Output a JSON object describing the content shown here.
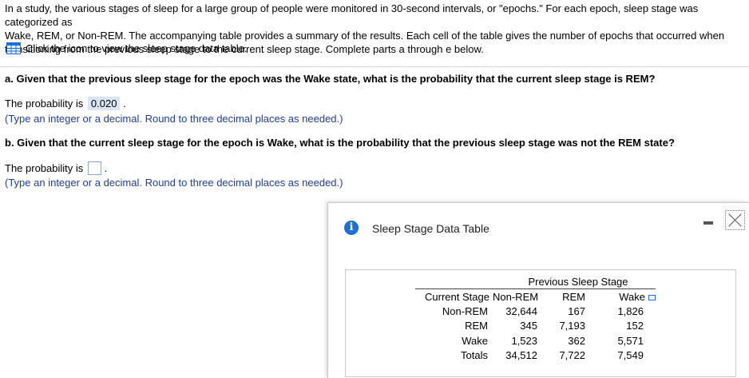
{
  "intro": {
    "line1": "In a study, the various stages of sleep for a large group of people were monitored in 30-second intervals, or \"epochs.\" For each epoch, sleep stage was categorized as",
    "line2": "Wake, REM, or Non-REM. The accompanying table provides a summary of the results. Each cell of the table gives the number of epochs that occurred when",
    "line3": "transitioning from the previous sleep stage to the current sleep stage. Complete parts a through e below.",
    "icon_link_text": "Click the icon to view the sleep stage data table."
  },
  "part_a": {
    "question": "a. Given that the previous sleep stage for the epoch was the Wake state, what is the probability that the current sleep stage is REM?",
    "answer_prefix": "The probability is",
    "answer_value": "0.020",
    "answer_suffix": ".",
    "hint": "(Type an integer or a decimal. Round to three decimal places as needed.)"
  },
  "part_b": {
    "question": "b. Given that the current sleep stage for the epoch is Wake, what is the probability that the previous sleep stage was not the REM state?",
    "answer_prefix": "The probability is",
    "answer_value": "",
    "answer_suffix": ".",
    "hint": "(Type an integer or a decimal. Round to three decimal places as needed.)"
  },
  "popup": {
    "title": "Sleep Stage Data Table",
    "table": {
      "group_header": "Previous Sleep Stage",
      "stub_header": "Current Stage",
      "columns": [
        "Non-REM",
        "REM",
        "Wake"
      ],
      "rows": [
        {
          "label": "Non-REM",
          "values": [
            "32,644",
            "167",
            "1,826"
          ]
        },
        {
          "label": "REM",
          "values": [
            "345",
            "7,193",
            "152"
          ]
        },
        {
          "label": "Wake",
          "values": [
            "1,523",
            "362",
            "5,571"
          ]
        },
        {
          "label": "Totals",
          "values": [
            "34,512",
            "7,722",
            "7,549"
          ]
        }
      ]
    }
  },
  "colors": {
    "hint_text": "#1f3f99",
    "answer_highlight": "#dbe5f7",
    "info_icon": "#1d6fd6"
  }
}
